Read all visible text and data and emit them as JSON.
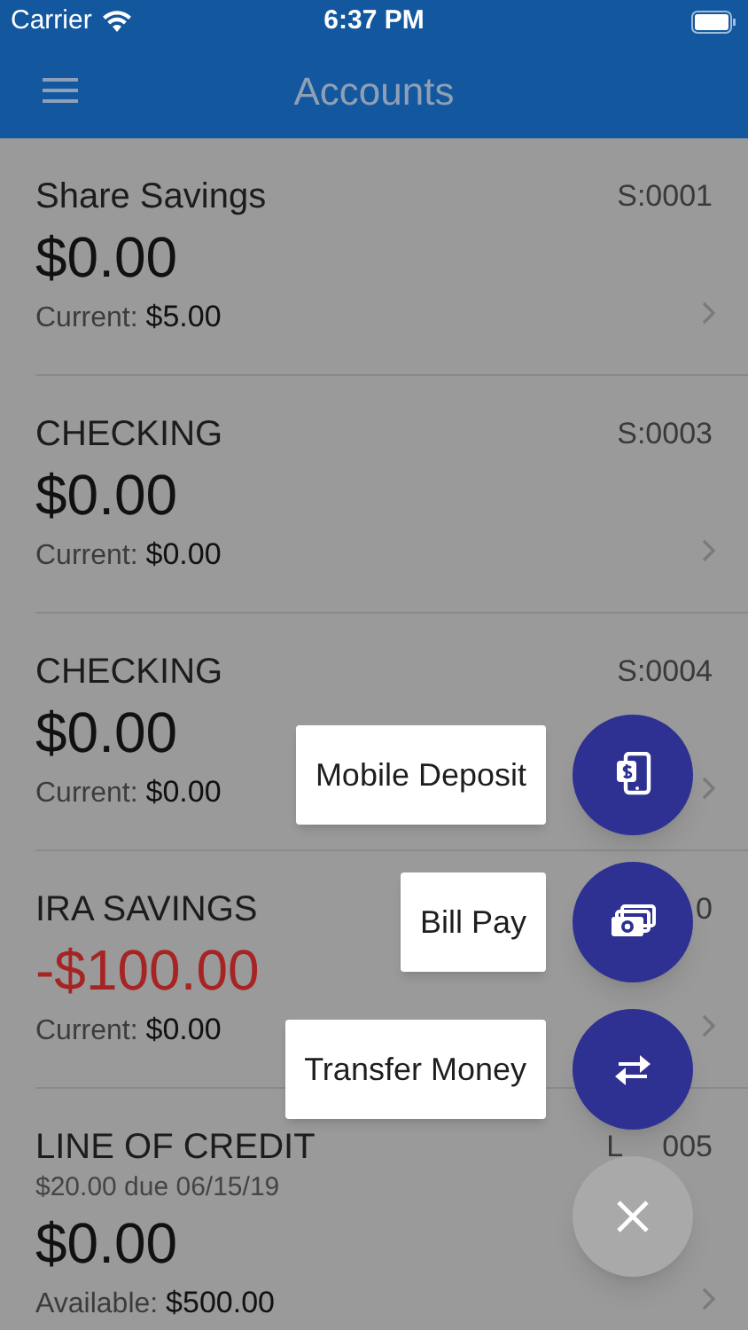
{
  "status_bar": {
    "carrier": "Carrier",
    "time": "6:37 PM"
  },
  "header": {
    "title": "Accounts"
  },
  "accounts": [
    {
      "name": "Share Savings",
      "number": "S:0001",
      "balance": "$0.00",
      "negative": false,
      "label": "Current:",
      "value": "$5.00"
    },
    {
      "name": "CHECKING",
      "number": "S:0003",
      "balance": "$0.00",
      "negative": false,
      "label": "Current:",
      "value": "$0.00"
    },
    {
      "name": "CHECKING",
      "number": "S:0004",
      "balance": "$0.00",
      "negative": false,
      "label": "Current:",
      "value": "$0.00"
    },
    {
      "name": "IRA SAVINGS",
      "number": "0",
      "balance": "-$100.00",
      "negative": true,
      "label": "Current:",
      "value": "$0.00"
    },
    {
      "name": "LINE OF CREDIT",
      "number": "L",
      "number_tail": "005",
      "due": "$20.00 due 06/15/19",
      "balance": "$0.00",
      "negative": false,
      "label": "Available:",
      "value": "$500.00"
    }
  ],
  "actions": [
    {
      "kind": "deposit",
      "label": "Mobile Deposit"
    },
    {
      "kind": "billpay",
      "label": "Bill Pay"
    },
    {
      "kind": "transfer",
      "label": "Transfer Money"
    }
  ]
}
